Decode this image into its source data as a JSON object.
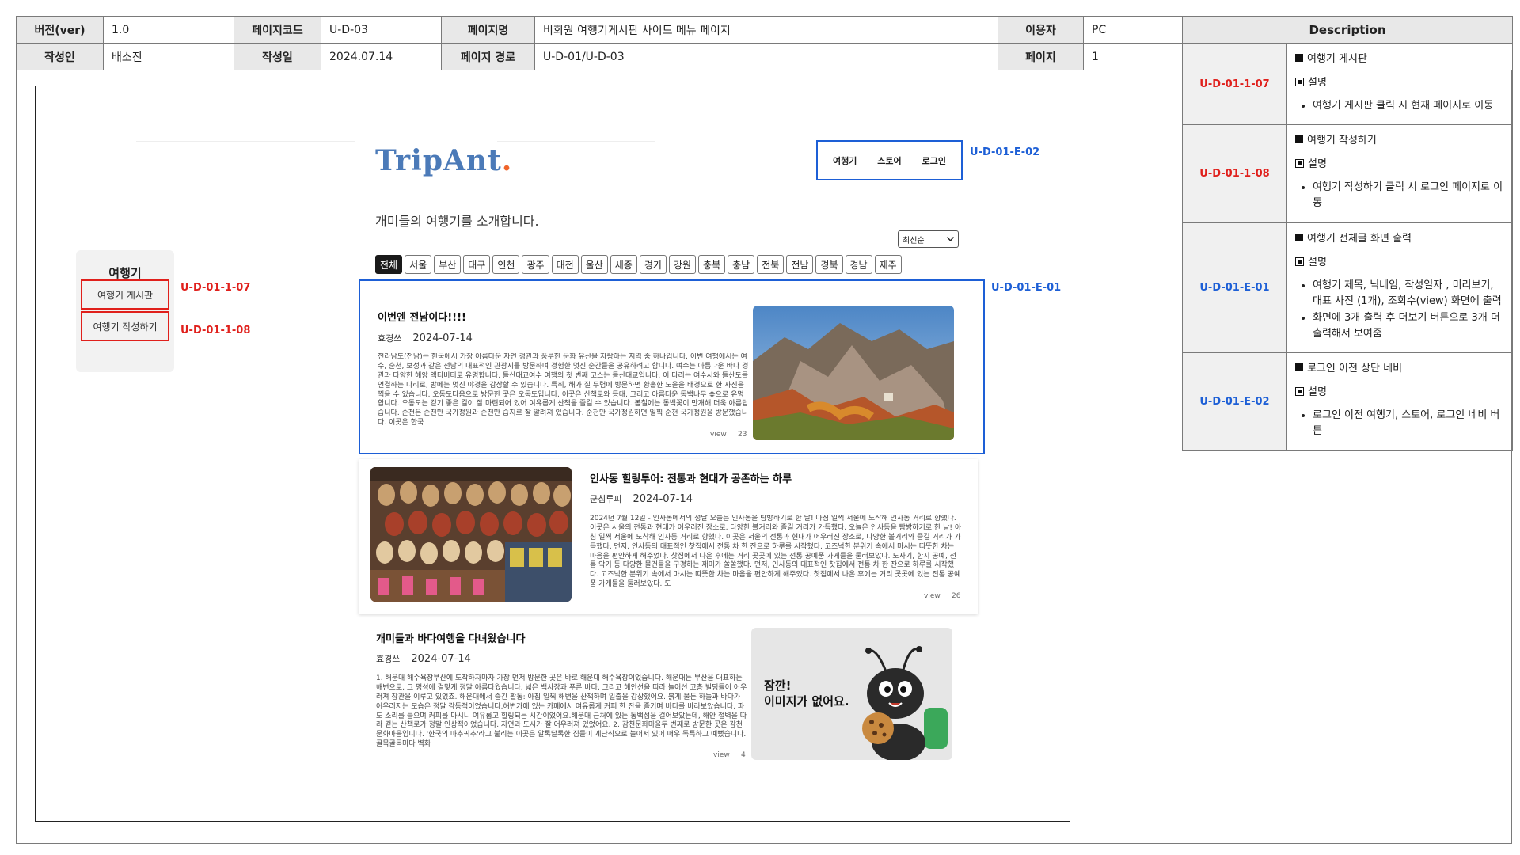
{
  "meta": {
    "version_label": "버전(ver)",
    "version": "1.0",
    "page_code_label": "페이지코드",
    "page_code": "U-D-03",
    "page_name_label": "페이지명",
    "page_name": "비회원 여행기게시판 사이드 메뉴 페이지",
    "user_label": "이용자",
    "user": "PC",
    "author_label": "작성인",
    "author": "배소진",
    "date_label": "작성일",
    "date": "2024.07.14",
    "path_label": "페이지 경로",
    "path": "U-D-01/U-D-03",
    "page_label": "페이지",
    "page": "1"
  },
  "description": {
    "header": "Description",
    "rows": [
      {
        "code": "U-D-01-1-07",
        "color": "red",
        "heading": "여행기 게시판",
        "sub": "설명",
        "bullets": [
          "여행기 게시판 클릭 시 현재 페이지로 이동"
        ]
      },
      {
        "code": "U-D-01-1-08",
        "color": "red",
        "heading": "여행기 작성하기",
        "sub": "설명",
        "bullets": [
          "여행기 작성하기 클릭 시 로그인 페이지로 이동"
        ]
      },
      {
        "code": "U-D-01-E-01",
        "color": "blue",
        "heading": "여행기 전체글 화면 출력",
        "sub": "설명",
        "bullets": [
          "여행기 제목, 닉네임, 작성일자 , 미리보기, 대표 사진 (1개), 조회수(view) 화면에 출력",
          "화면에 3개 출력 후 더보기 버튼으로 3개 더 출력해서 보여줌"
        ]
      },
      {
        "code": "U-D-01-E-02",
        "color": "blue",
        "heading": "로그인 이전 상단 네비",
        "sub": "설명",
        "bullets": [
          "로그인 이전 여행기, 스토어, 로그인 네비 버튼"
        ]
      }
    ]
  },
  "side_menu": {
    "title": "여행기",
    "items": [
      "여행기 게시판",
      "여행기 작성하기"
    ]
  },
  "annotations": {
    "board": "U-D-01-1-07",
    "write": "U-D-01-1-08",
    "nav": "U-D-01-E-02",
    "posts": "U-D-01-E-01"
  },
  "site": {
    "logo_main": "TripAnt",
    "logo_dot": ".",
    "nav": [
      "여행기",
      "스토어",
      "로그인"
    ],
    "tagline": "개미들의 여행기를 소개합니다.",
    "sort_selected": "최신순",
    "regions": [
      "전체",
      "서울",
      "부산",
      "대구",
      "인천",
      "광주",
      "대전",
      "울산",
      "세종",
      "경기",
      "강원",
      "충북",
      "충남",
      "전북",
      "전남",
      "경북",
      "경남",
      "제주"
    ]
  },
  "posts": [
    {
      "title": "이번엔 전남이다!!!!",
      "author": "효경쓰",
      "date": "2024-07-14",
      "body": "전라남도(전남)는 한국에서 가장 아름다운 자연 경관과 풍부한 문화 유산을 자랑하는 지역 중 하나입니다. 이번 여행에서는 여수, 순천, 보성과 같은 전남의 대표적인 관광지를 방문하며 경험한 멋진 순간들을 공유하려고 합니다. 여수는 아름다운 바다 경관과 다양한 해양 액티비티로 유명합니다. 돌산대교여수 여행의 첫 번째 코스는 돌산대교입니다. 이 다리는 여수시와 돌산도를 연결하는 다리로, 밤에는 멋진 야경을 감상할 수 있습니다. 특히, 해가 질 무렵에 방문하면 황홀한 노을을 배경으로 한 사진을 찍을 수 있습니다. 오동도다음으로 방문한 곳은 오동도입니다. 이곳은 산책로와 등대, 그리고 아름다운 동백나무 숲으로 유명합니다. 오동도는 걷기 좋은 길이 잘 마련되어 있어 여유롭게 산책을 즐길 수 있습니다. 봄철에는 동백꽃이 만개해 더욱 아름답습니다. 순천은 순천만 국가정원과 순천만 습지로 잘 알려져 있습니다. 순천만 국가정원하면 일찍 순천 국가정원을 방문했습니다. 이곳은 한국",
      "views_label": "view",
      "views": "23",
      "image": "mountain"
    },
    {
      "title": "인사동 힐링투어: 전통과 현대가 공존하는 하루",
      "author": "군침루피",
      "date": "2024-07-14",
      "body": "2024년 7월 12일 - 인사동에서의 정날 오늘은 인사동을 탐방하기로 한 날! 아침 일찍 서울에 도착해 인사동 거리로 향했다. 이곳은 서울의 전통과 현대가 어우러진 장소로, 다양한 볼거리와 즐길 거리가 가득했다. 오늘은 인사동을 탐방하기로 한 날! 아침 일찍 서울에 도착해 인사동 거리로 향했다. 이곳은 서울의 전통과 현대가 어우러진 장소로, 다양한 볼거리와 즐길 거리가 가득했다. 먼저, 인사동의 대표적인 찻집에서 전통 차 한 잔으로 하루를 시작했다. 고즈넉한 분위기 속에서 마시는 따뜻한 차는 마음을 편안하게 해주었다. 찻집에서 나온 후에는 거리 곳곳에 있는 전통 공예품 가게들을 둘러보았다. 도자기, 한지 공예, 전통 악기 등 다양한 물건들을 구경하는 재미가 쏠쏠했다. 먼저, 인사동의 대표적인 찻집에서 전통 차 한 잔으로 하루를 시작했다. 고즈넉한 분위기 속에서 마시는 따뜻한 차는 마음을 편안하게 해주었다. 찻집에서 나온 후에는 거리 곳곳에 있는 전통 공예품 가게들을 둘러보았다. 도",
      "views_label": "view",
      "views": "26",
      "image": "masks"
    },
    {
      "title": "개미들과 바다여행을 다녀왔습니다",
      "author": "효경쓰",
      "date": "2024-07-14",
      "body": "1. 해운대 해수욕장부산에 도착하자마자 가장 먼저 방문한 곳은 바로 해운대 해수욕장이었습니다. 해운대는 부산을 대표하는 해변으로, 그 명성에 걸맞게 정말 아름다웠습니다. 넓은 백사장과 푸른 바다, 그리고 해안선을 따라 늘어선 고층 빌딩들이 어우러져 장관을 이루고 있었죠. 해운대에서 즐긴 활동: 아침 일찍 해변을 산책하며 일출을 감상했어요. 붉게 물든 하늘과 바다가 어우러지는 모습은 정말 감동적이었습니다.해변가에 있는 카페에서 여유롭게 커피 한 잔을 즐기며 바다를 바라보았습니다. 파도 소리를 들으며 커피를 마시니 여유롭고 힐링되는 시간이었어요.해운대 근처에 있는 동백섬을 걸어보았는데, 해안 절벽을 따라 걷는 산책로가 정말 인상적이었습니다. 자연과 도시가 잘 어우러져 있었어요. 2. 감천문화마을두 번째로 방문한 곳은 감천문화마을입니다. '한국의 마추픽추'라고 불리는 이곳은 알록달록한 집들이 계단식으로 늘어서 있어 매우 독특하고 예뻤습니다. 골목골목마다 벽화",
      "views_label": "view",
      "views": "4",
      "image": "placeholder",
      "placeholder_text_1": "잠깐!",
      "placeholder_text_2": "이미지가 없어요."
    }
  ]
}
